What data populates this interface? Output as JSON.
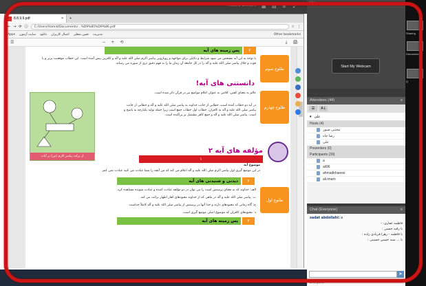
{
  "webinar": {
    "record_label": "Record Content",
    "video_title": "Video",
    "webcam_button": "Start My Webcam",
    "attendees_title": "Attendees (44)",
    "me_name": "علی",
    "hosts_header": "Hosts (4)",
    "hosts": [
      "مجتبی صبور",
      "رضا جاه",
      "علی"
    ],
    "presenters_header": "Presenters (0)",
    "participants_header": "Participants (39)",
    "participants": [
      "a",
      "ali96",
      "ahmadkhaeesi",
      "ali.imam"
    ],
    "chat_title": "Chat (Everyone)",
    "chat_messages": [
      {
        "who": "sadat abdollahi:",
        "text": "a"
      },
      {
        "who": "",
        "text": "فاطمه غفاری: -"
      },
      {
        "who": "",
        "text": "یا رقیه حسین :"
      },
      {
        "who": "",
        "text": "یا فاطمه - زهرا فریادی زاده :"
      },
      {
        "who": "",
        "text": "یا ... سید حسین حسینی :"
      }
    ],
    "chat_target": "Everyone",
    "far_labels": [
      "Sharing",
      "Discussion",
      "Q"
    ]
  },
  "browser": {
    "tab_title": "8.8.9.9.pdf",
    "url": "C:/Users/Hamid/Documents/...%D9%85%D9%86.pdf",
    "bookmarks": [
      "Apps",
      "سایت آزمون",
      "دانلود",
      "اتصال کاربران",
      "تعیین شغلی",
      "مدیریت",
      "Other bookmarks"
    ],
    "pdf_toolbar": [
      "−",
      "+",
      "⟲",
      "⤓",
      "🖨"
    ]
  },
  "page": {
    "s1_num": "۲",
    "s1_title": "پس زمینه های آیه",
    "s1_side": "طلوع سوم",
    "s1_text": "با توجه به این آیه مشخص می شود شرایط و دلایلی برای مواجهه و رویارویی پیامبر اکرم صلی الله علیه و آله و کافرین پیش آمده است. این خطاب موقعیت برتر و با قوت و جلال پیامبر صلی الله علیه و آله را در کل جامعه آن زمان ما را به فهم دقیق تری از سوره می رساند.",
    "s2_title": "دانستنی های آیه!",
    "s2_side": "طلوع چهارم",
    "s2_text1": "عالم به معنای کفتن، کلامی به عنوان اعلام مواضع نیز در قرآن ذکر شده است.",
    "s2_text2": "در آیه دو خطاب آمده است، خطابی از جانب خداوند به پیامبر صلی الله علیه و آله و خطابی از جانب پیامبر صلی الله علیه و آله به کافران. خطاب اول خطاب جمع است زیرا جمله تولید یکپارچه به پاسخ و است. پیامبر صلی الله علیه و آله و جمع کافر مشتمل بر پراکنده است.",
    "diagram_caption": "از برکت پیامبر اکرم (ص) بر آیات",
    "s3_title": "مؤلفه های آیه ۲",
    "s3_num": "۱",
    "s3_sub": "موضوع آیه",
    "s3_text": "در این موضع گیری اول پیامبر اکرم صلی الله علیه و آله اعلام می کند که من آنچه را شما عبادت می کنید عبادت نمی کنم.",
    "s3_side": "طلوع اول",
    "s4_num": "۲",
    "s4_title": "دیدنی و شنیدنی های آیه",
    "s4_text1": "الف: خداوند که به معنای پرستش است را می توان در دو مؤلفه عبادت کننده و عبادت شونده مشاهده کرد.",
    "s4_text2": "ب: پیامبر صلی الله علیه و آله در ماهی که از خداوند معبودهای کفار اظهار برائت می کند.",
    "s4_text3": "ج: گاه زمانی که معبودهای دارند و خدا آنها در پرستش از پیامبر صلی الله علیه و آله کاملاً جداست.",
    "s4_text4": "د: معبودهای کافران که موضوع اصلی موضع گیری است.",
    "s5_num": "۳",
    "s5_title": "پس زمینه های آیه"
  }
}
